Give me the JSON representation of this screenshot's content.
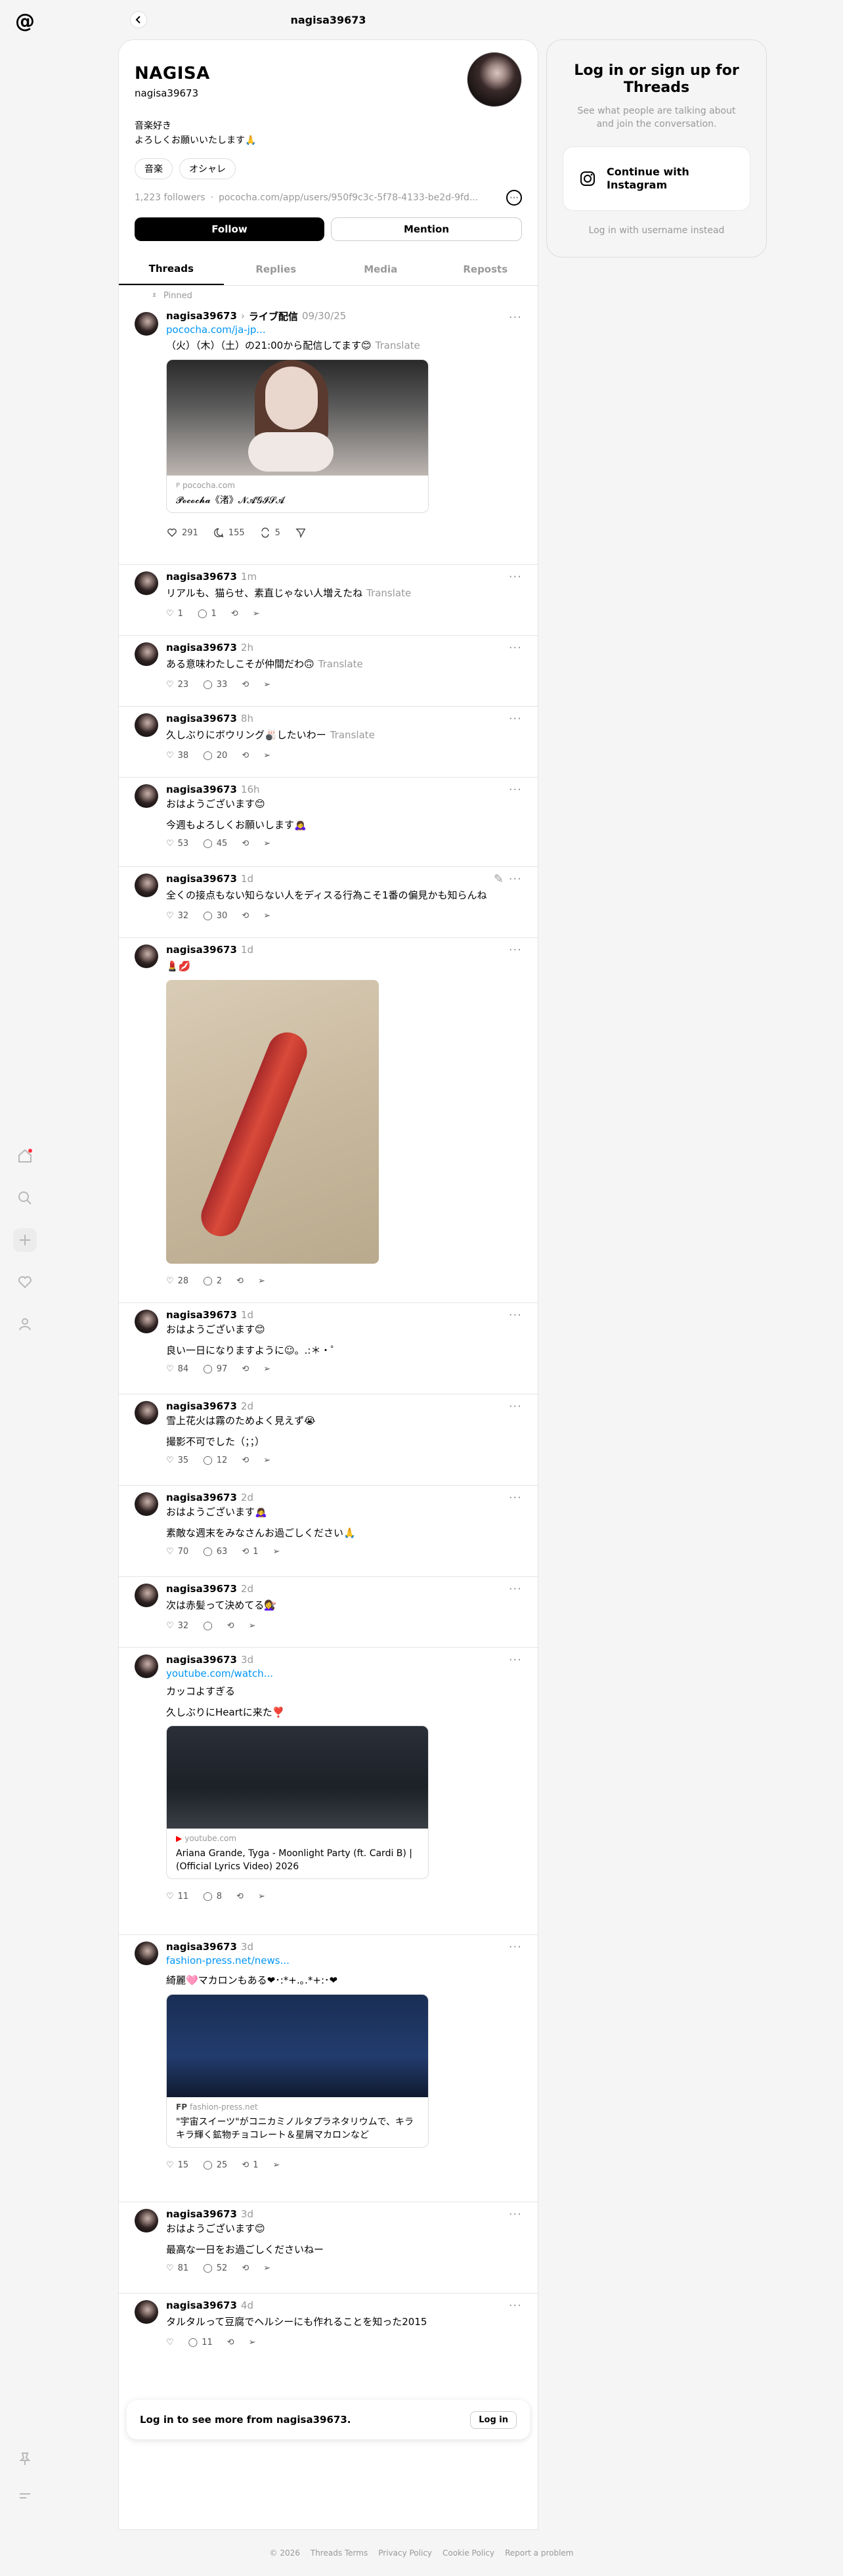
{
  "app": {
    "title": "nagisa39673"
  },
  "profile": {
    "display_name": "NAGISA",
    "username": "nagisa39673",
    "bio": "音楽好き\nよろしくお願いいたします🙏",
    "tags": [
      "音楽",
      "オシャレ"
    ],
    "followers": "1,223 followers",
    "link": "pococha.com/app/users/950f9c3c-5f78-4133-be2d-9fd...",
    "follow_label": "Follow",
    "mention_label": "Mention"
  },
  "tabs": [
    "Threads",
    "Replies",
    "Media",
    "Reposts"
  ],
  "posts": [
    {
      "pinned": "Pinned",
      "user": "nagisa39673",
      "tag": "ライブ配信",
      "time": "09/30/25",
      "link": "pococha.com/ja-jp...",
      "text": "（火）（木）（土）の21:00から配信してます😊",
      "translate": "Translate",
      "card_source": "pococha.com",
      "card_title": "𝓟𝓸𝓬𝓸𝓬𝓱𝓪《渚》𝓝𝓐𝓖𝓘𝓢𝓐",
      "likes": "291",
      "replies": "155",
      "reposts": "5"
    },
    {
      "user": "nagisa39673",
      "time": "1m",
      "text": "リアルも、猫らせ、素直じゃない人増えたね",
      "translate": "Translate",
      "likes": "1",
      "replies": "1"
    },
    {
      "user": "nagisa39673",
      "time": "2h",
      "text": "ある意味わたしこそが仲間だわ🙃",
      "translate": "Translate",
      "likes": "23",
      "replies": "33"
    },
    {
      "user": "nagisa39673",
      "time": "8h",
      "text": "久しぶりにボウリング🎳したいわー",
      "translate": "Translate",
      "likes": "38",
      "replies": "20"
    },
    {
      "user": "nagisa39673",
      "time": "16h",
      "text": "おはようございます😊\n\n今週もよろしくお願いします🙇‍♀️",
      "likes": "53",
      "replies": "45"
    },
    {
      "user": "nagisa39673",
      "time": "1d",
      "text": "全くの接点もない知らない人をディスる行為こそ1番の偏見かも知らんね",
      "likes": "32",
      "replies": "30"
    },
    {
      "user": "nagisa39673",
      "time": "1d",
      "text": "💄💋",
      "likes": "28",
      "replies": "2"
    },
    {
      "user": "nagisa39673",
      "time": "1d",
      "text": "おはようございます😊\n\n良い一日になりますように☺︎。.:＊・゜",
      "likes": "84",
      "replies": "97"
    },
    {
      "user": "nagisa39673",
      "time": "2d",
      "text": "雪上花火は霧のためよく見えず😭\n\n撮影不可でした（；；）",
      "likes": "35",
      "replies": "12"
    },
    {
      "user": "nagisa39673",
      "time": "2d",
      "text": "おはようございます🙇‍♀️\n\n素敵な週末をみなさんお過ごしください🙏",
      "likes": "70",
      "replies": "63",
      "reposts": "1"
    },
    {
      "user": "nagisa39673",
      "time": "2d",
      "text": "次は赤髪って決めてる💇‍♀️",
      "likes": "32"
    },
    {
      "user": "nagisa39673",
      "time": "3d",
      "link": "youtube.com/watch...",
      "text": "カッコよすぎる\n\n久しぶりにHeartに来た❣️",
      "card_source": "youtube.com",
      "card_title": "Ariana Grande, Tyga - Moonlight Party (ft. Cardi B) | (Official Lyrics Video) 2026",
      "likes": "11",
      "replies": "8"
    },
    {
      "user": "nagisa39673",
      "time": "3d",
      "link": "fashion-press.net/news...",
      "text": "綺麗🩷マカロンもある❤︎･:*+.｡.*+:･❤︎",
      "card_source": "fashion-press.net",
      "card_title": "\"宇宙スイーツ\"がコニカミノルタプラネタリウムで、キラキラ輝く鉱物チョコレート＆星屑マカロンなど",
      "likes": "15",
      "replies": "25",
      "reposts": "1"
    },
    {
      "user": "nagisa39673",
      "time": "3d",
      "text": "おはようございます😊\n\n最高な一日をお過ごしくださいねー",
      "likes": "81",
      "replies": "52"
    },
    {
      "user": "nagisa39673",
      "time": "4d",
      "text": "タルタルって豆腐でヘルシーにも作れることを知った2015",
      "replies": "11"
    }
  ],
  "login_bar": {
    "text": "Log in to see more from nagisa39673.",
    "button": "Log in"
  },
  "side": {
    "heading": "Log in or sign up for Threads",
    "sub": "See what people are talking about and join the conversation.",
    "instagram_label": "Continue with Instagram",
    "alt_label": "Log in with username instead"
  },
  "footer": [
    "© 2026",
    "Threads Terms",
    "Privacy Policy",
    "Cookie Policy",
    "Report a problem"
  ],
  "colors": {
    "link": "#0095f6",
    "muted": "#999999",
    "accent": "#ff3040"
  }
}
